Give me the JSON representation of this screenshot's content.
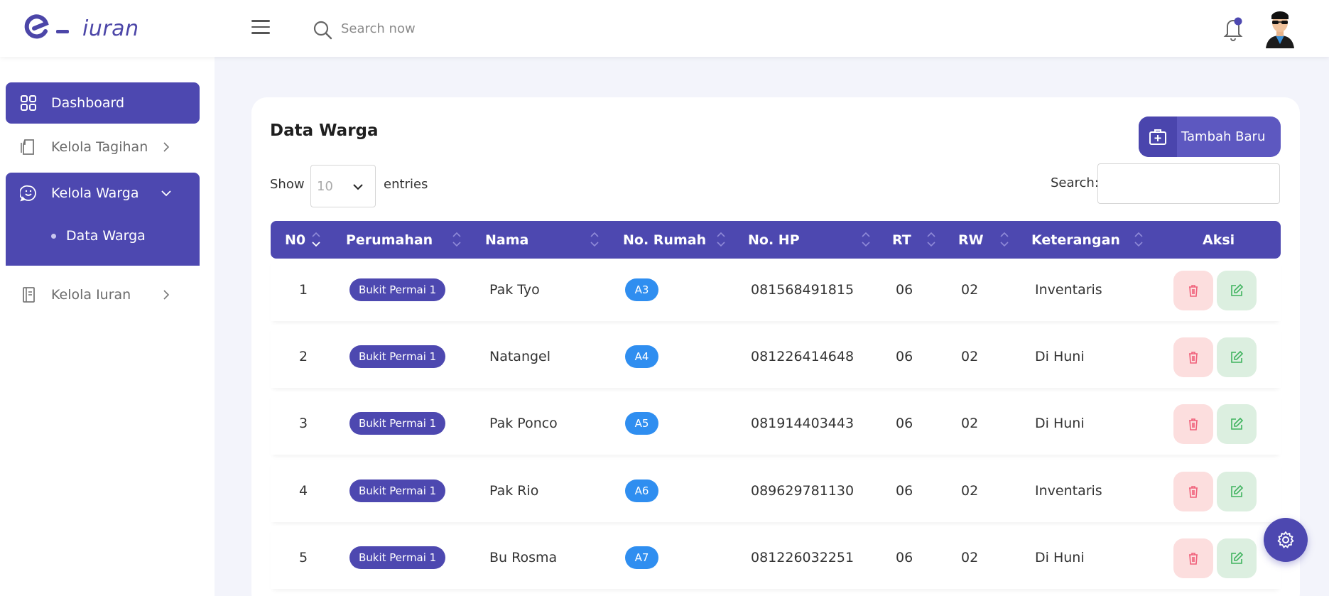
{
  "app": {
    "logo_text": "iuran",
    "brand_color": "#4d48b0"
  },
  "header": {
    "search_placeholder": "Search now",
    "icons": [
      "menu-icon",
      "search-icon",
      "bell-icon",
      "user-avatar"
    ]
  },
  "sidebar": {
    "items": [
      {
        "label": "Dashboard",
        "icon": "grid-icon",
        "active": true
      },
      {
        "label": "Kelola Tagihan",
        "icon": "document-icon",
        "expanded": false
      },
      {
        "label": "Kelola Warga",
        "icon": "chat-smile-icon",
        "expanded": true,
        "children": [
          {
            "label": "Data Warga"
          }
        ]
      },
      {
        "label": "Kelola Iuran",
        "icon": "notebook-icon",
        "expanded": false
      }
    ]
  },
  "main": {
    "title": "Data Warga",
    "add_button": "Tambah Baru",
    "show_label": "Show",
    "entries_value": "10",
    "entries_label": "entries",
    "search_label": "Search:",
    "columns": [
      "N0",
      "Perumahan",
      "Nama",
      "No. Rumah",
      "No. HP",
      "RT",
      "RW",
      "Keterangan",
      "Aksi"
    ],
    "rows": [
      {
        "no": "1",
        "perumahan": "Bukit Permai 1",
        "nama": "Pak Tyo",
        "rumah": "A3",
        "hp": "081568491815",
        "rt": "06",
        "rw": "02",
        "ket": "Inventaris"
      },
      {
        "no": "2",
        "perumahan": "Bukit Permai 1",
        "nama": "Natangel",
        "rumah": "A4",
        "hp": "081226414648",
        "rt": "06",
        "rw": "02",
        "ket": "Di Huni"
      },
      {
        "no": "3",
        "perumahan": "Bukit Permai 1",
        "nama": "Pak Ponco",
        "rumah": "A5",
        "hp": "081914403443",
        "rt": "06",
        "rw": "02",
        "ket": "Di Huni"
      },
      {
        "no": "4",
        "perumahan": "Bukit Permai 1",
        "nama": "Pak Rio",
        "rumah": "A6",
        "hp": "089629781130",
        "rt": "06",
        "rw": "02",
        "ket": "Inventaris"
      },
      {
        "no": "5",
        "perumahan": "Bukit Permai 1",
        "nama": "Bu Rosma",
        "rumah": "A7",
        "hp": "081226032251",
        "rt": "06",
        "rw": "02",
        "ket": "Di Huni"
      }
    ]
  },
  "fab": {
    "icon": "gear-icon"
  }
}
